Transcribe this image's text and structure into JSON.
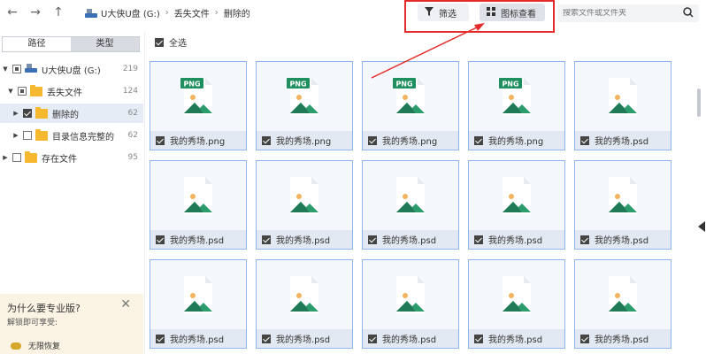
{
  "toolbar": {
    "breadcrumb": [
      "U大侠U盘 (G:)",
      "丢失文件",
      "删除的"
    ],
    "filter_label": "筛选",
    "view_label": "图标查看",
    "search_placeholder": "搜索文件或文件夹"
  },
  "sidebar": {
    "tabs": [
      "路径",
      "类型"
    ],
    "tree": [
      {
        "label": "U大侠U盘 (G:)",
        "count": "219"
      },
      {
        "label": "丢失文件",
        "count": "124"
      },
      {
        "label": "删除的",
        "count": "62"
      },
      {
        "label": "目录信息完整的",
        "count": "62"
      },
      {
        "label": "存在文件",
        "count": "95"
      }
    ]
  },
  "promo": {
    "title": "为什么要专业版?",
    "subtitle": "解锁即可享受:",
    "item": "无限恢复"
  },
  "main": {
    "select_all": "全选",
    "files": [
      {
        "name": "我的秀场.png",
        "type": "PNG"
      },
      {
        "name": "我的秀场.png",
        "type": "PNG"
      },
      {
        "name": "我的秀场.png",
        "type": "PNG"
      },
      {
        "name": "我的秀场.png",
        "type": "PNG"
      },
      {
        "name": "我的秀场.psd",
        "type": ""
      },
      {
        "name": "我的秀场.psd",
        "type": ""
      },
      {
        "name": "我的秀场.psd",
        "type": ""
      },
      {
        "name": "我的秀场.psd",
        "type": ""
      },
      {
        "name": "我的秀场.psd",
        "type": ""
      },
      {
        "name": "我的秀场.psd",
        "type": ""
      },
      {
        "name": "我的秀场.psd",
        "type": ""
      },
      {
        "name": "我的秀场.psd",
        "type": ""
      },
      {
        "name": "我的秀场.psd",
        "type": ""
      },
      {
        "name": "我的秀场.psd",
        "type": ""
      },
      {
        "name": "我的秀场.psd",
        "type": ""
      }
    ]
  },
  "colors": {
    "accent": "#2d9c6d",
    "badge": "#1f8f5f",
    "highlight": "#e52a2a",
    "folder": "#f5b82e"
  }
}
